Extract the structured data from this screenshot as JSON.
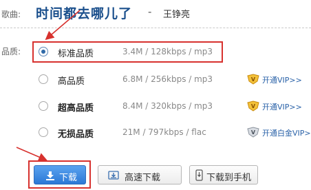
{
  "song": {
    "label": "歌曲:",
    "title": "时间都去哪儿了",
    "dash": "-",
    "artist": "王铮亮"
  },
  "quality": {
    "label": "品质:",
    "options": [
      {
        "name": "标准品质",
        "spec": "3.4M / 128kbps / mp3",
        "selected": true,
        "vip": ""
      },
      {
        "name": "高品质",
        "spec": "6.8M / 256kbps / mp3",
        "selected": false,
        "vip": "开通VIP>>"
      },
      {
        "name": "超高品质",
        "spec": "8.4M / 320kbps / mp3",
        "selected": false,
        "vip": "开通VIP>>"
      },
      {
        "name": "无损品质",
        "spec": "21M / 797kbps / flac",
        "selected": false,
        "vip": "开通白金VIP>>"
      }
    ]
  },
  "buttons": {
    "download": "下载",
    "fast_download": "高速下载",
    "download_to_phone": "下载到手机"
  },
  "colors": {
    "accent": "#2b78d6",
    "annotation": "#d7312e",
    "title": "#1a4f8c",
    "vip_badge": "#e8a317"
  }
}
